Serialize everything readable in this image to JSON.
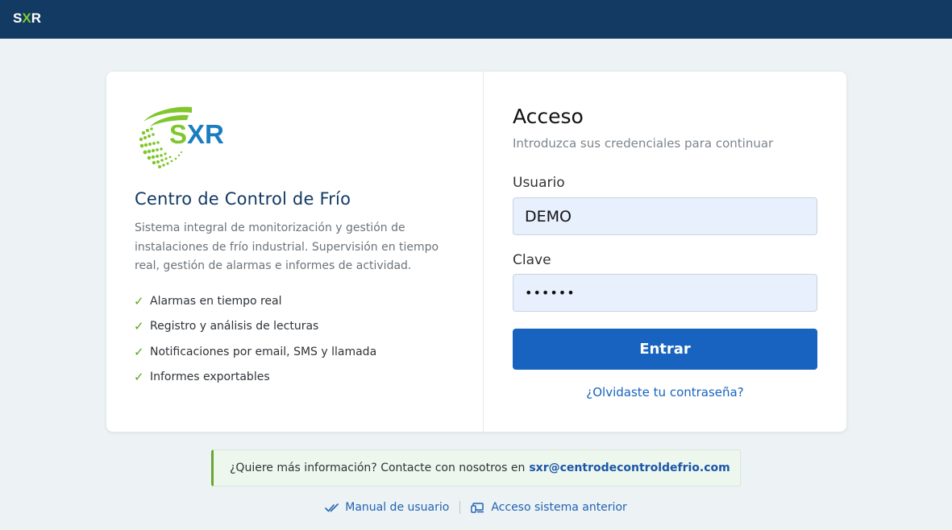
{
  "topbar": {
    "logo_s": "S",
    "logo_x": "X",
    "logo_r": "R"
  },
  "brand": {
    "logo_text": "SXR",
    "title": "Centro de Control de Frío",
    "description": "Sistema integral de monitorización y gestión de instalaciones de frío industrial. Supervisión en tiempo real, gestión de alarmas e informes de actividad.",
    "features": [
      "Alarmas en tiempo real",
      "Registro y análisis de lecturas",
      "Notificaciones por email, SMS y llamada",
      "Informes exportables"
    ],
    "check_glyph": "✓"
  },
  "login": {
    "title": "Acceso",
    "subtitle": "Introduzca sus credenciales para continuar",
    "user_label": "Usuario",
    "user_value": "DEMO",
    "password_label": "Clave",
    "password_value": "••••••",
    "submit_label": "Entrar",
    "forgot_label": "¿Olvidaste tu contraseña?"
  },
  "info": {
    "text": "¿Quiere más información? Contacte con nosotros en",
    "email": "sxr@centrodecontroldefrio.com"
  },
  "footer": {
    "manual_label": "Manual de usuario",
    "legacy_label": "Acceso sistema anterior"
  },
  "colors": {
    "topbar": "#123a63",
    "brand_green": "#7fcb2a",
    "brand_blue": "#1a7dc0",
    "primary_button": "#1763bf",
    "check": "#5aa51c"
  },
  "icons": {
    "manual": "double-check-icon",
    "legacy": "devices-icon"
  }
}
